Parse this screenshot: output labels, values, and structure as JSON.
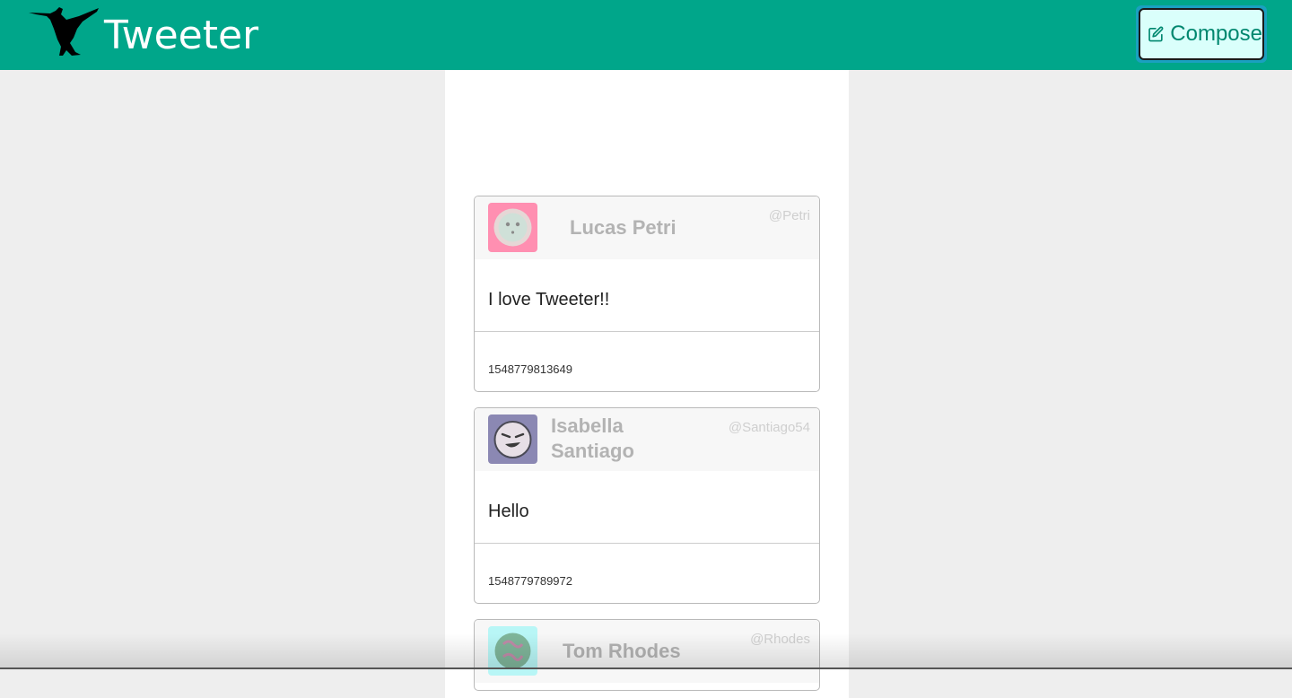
{
  "header": {
    "brand": "Tweeter",
    "compose_label": "Compose",
    "background": "#00a68a"
  },
  "tweets": [
    {
      "name": "Lucas Petri",
      "handle": "@Petri",
      "text": "I love Tweeter!!",
      "time": "1548779813649",
      "avatar_color": "#ff8fb1"
    },
    {
      "name_line1": "Isabella",
      "name_line2": "Santiago",
      "handle": "@Santiago54",
      "text": "Hello",
      "time": "1548779789972",
      "avatar_color": "#8b88b3"
    },
    {
      "name": "Tom Rhodes",
      "handle": "@Rhodes",
      "avatar_color": "#b8f6f6"
    }
  ]
}
